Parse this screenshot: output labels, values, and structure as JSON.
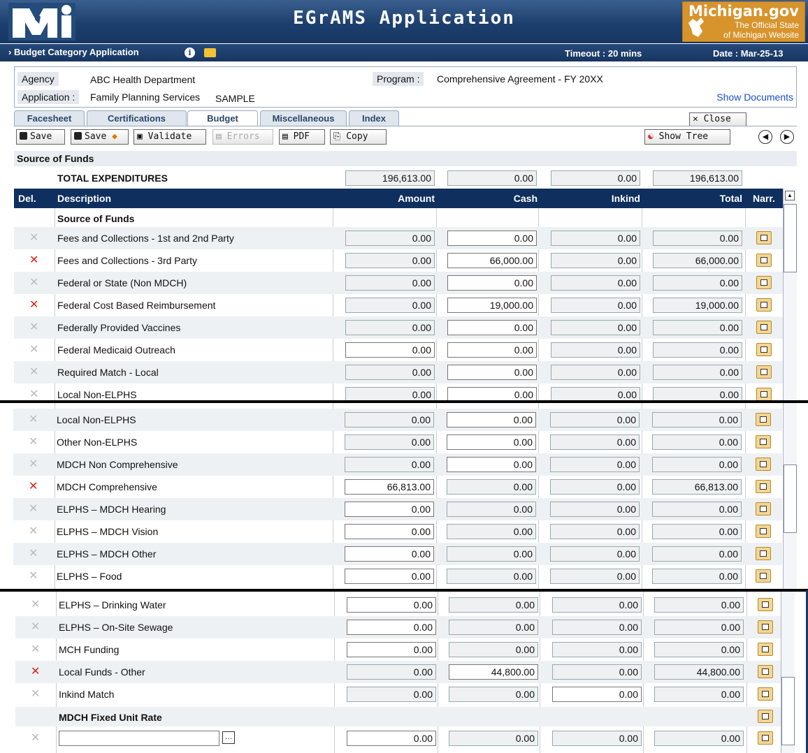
{
  "header": {
    "title": "EGrAMS Application",
    "badge_big": "Michigan.gov",
    "badge_small_1": "The Official State",
    "badge_small_2": "of Michigan Website"
  },
  "subbar": {
    "title": "Budget Category Application",
    "timeout": "Timeout : 20 mins",
    "date": "Date : Mar-25-13"
  },
  "info": {
    "agency_label": "Agency",
    "agency": "ABC Health Department",
    "program_label": "Program :",
    "program": "Comprehensive Agreement - FY 20XX",
    "application_label": "Application :",
    "application": "Family Planning Services",
    "sample": "SAMPLE",
    "show_documents": "Show Documents"
  },
  "tabs": [
    "Facesheet",
    "Certifications",
    "Budget",
    "Miscellaneous",
    "Index"
  ],
  "toolbar": {
    "save": "Save",
    "save_as": "Save",
    "validate": "Validate",
    "errors": "Errors",
    "pdf": "PDF",
    "copy": "Copy",
    "show_tree": "Show Tree",
    "close": "Close"
  },
  "section_title": "Source of Funds",
  "totals": {
    "label": "TOTAL EXPENDITURES",
    "amount": "196,613.00",
    "cash": "0.00",
    "inkind": "0.00",
    "total": "196,613.00"
  },
  "columns": {
    "del": "Del.",
    "description": "Description",
    "amount": "Amount",
    "cash": "Cash",
    "inkind": "Inkind",
    "total": "Total",
    "narr": "Narr."
  },
  "panel1": {
    "heading": "Source of Funds",
    "rows": [
      [
        "Fees and Collections - 1st and 2nd Party",
        "0.00",
        "0.00",
        "0.00",
        "0.00"
      ],
      [
        "Fees and Collections - 3rd Party",
        "0.00",
        "66,000.00",
        "0.00",
        "66,000.00"
      ],
      [
        "Federal or State (Non MDCH)",
        "0.00",
        "0.00",
        "0.00",
        "0.00"
      ],
      [
        "Federal Cost Based Reimbursement",
        "0.00",
        "19,000.00",
        "0.00",
        "19,000.00"
      ],
      [
        "Federally Provided Vaccines",
        "0.00",
        "0.00",
        "0.00",
        "0.00"
      ],
      [
        "Federal Medicaid Outreach",
        "0.00",
        "0.00",
        "0.00",
        "0.00"
      ],
      [
        "Required Match - Local",
        "0.00",
        "0.00",
        "0.00",
        "0.00"
      ],
      [
        "Local Non-ELPHS",
        "0.00",
        "0.00",
        "0.00",
        "0.00"
      ]
    ]
  },
  "panel2": {
    "rows": [
      [
        "Local Non-ELPHS",
        "0.00",
        "0.00",
        "0.00",
        "0.00"
      ],
      [
        "Other Non-ELPHS",
        "0.00",
        "0.00",
        "0.00",
        "0.00"
      ],
      [
        "MDCH Non Comprehensive",
        "0.00",
        "0.00",
        "0.00",
        "0.00"
      ],
      [
        "MDCH Comprehensive",
        "66,813.00",
        "0.00",
        "0.00",
        "66,813.00"
      ],
      [
        "ELPHS – MDCH Hearing",
        "0.00",
        "0.00",
        "0.00",
        "0.00"
      ],
      [
        "ELPHS – MDCH Vision",
        "0.00",
        "0.00",
        "0.00",
        "0.00"
      ],
      [
        "ELPHS – MDCH Other",
        "0.00",
        "0.00",
        "0.00",
        "0.00"
      ],
      [
        "ELPHS – Food",
        "0.00",
        "0.00",
        "0.00",
        "0.00"
      ]
    ]
  },
  "panel3": {
    "rows": [
      [
        "ELPHS – Drinking Water",
        "0.00",
        "0.00",
        "0.00",
        "0.00"
      ],
      [
        "ELPHS – On-Site Sewage",
        "0.00",
        "0.00",
        "0.00",
        "0.00"
      ],
      [
        "MCH Funding",
        "0.00",
        "0.00",
        "0.00",
        "0.00"
      ],
      [
        "Local Funds - Other",
        "0.00",
        "44,800.00",
        "0.00",
        "44,800.00"
      ],
      [
        "Inkind Match",
        "0.00",
        "0.00",
        "0.00",
        "0.00"
      ]
    ],
    "fixed_heading": "MDCH Fixed Unit Rate",
    "fixed_row": [
      "",
      "0.00",
      "0.00",
      "0.00",
      "0.00"
    ]
  }
}
